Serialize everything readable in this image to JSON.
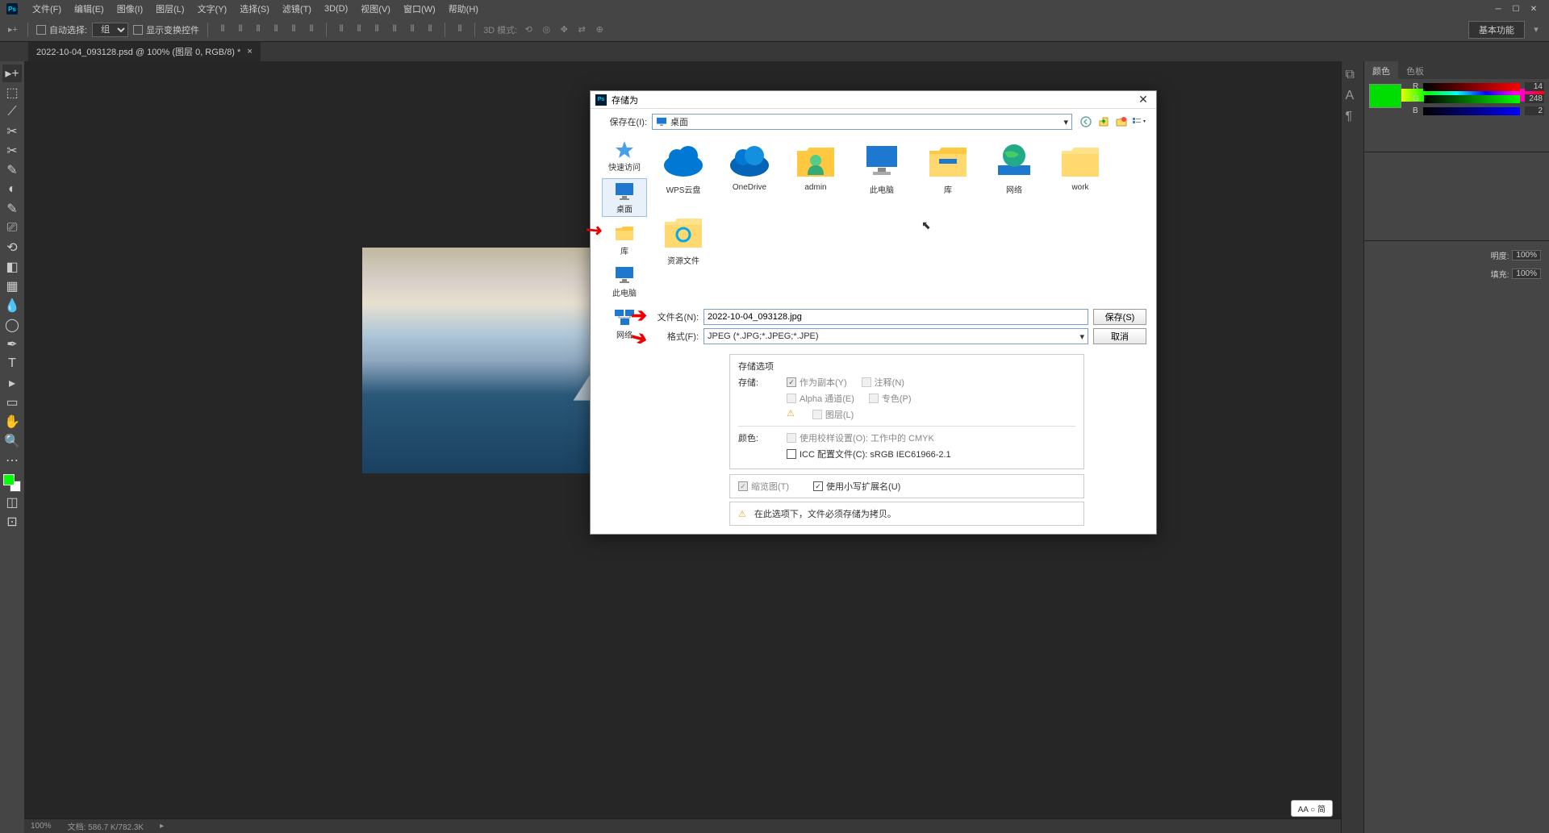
{
  "app": {
    "name": "Ps"
  },
  "menubar": {
    "items": [
      "文件(F)",
      "编辑(E)",
      "图像(I)",
      "图层(L)",
      "文字(Y)",
      "选择(S)",
      "滤镜(T)",
      "3D(D)",
      "视图(V)",
      "窗口(W)",
      "帮助(H)"
    ]
  },
  "optionsbar": {
    "auto_select": "自动选择:",
    "group": "组",
    "show_transform": "显示变换控件",
    "mode_3d": "3D 模式:",
    "basic_func": "基本功能"
  },
  "document_tab": "2022-10-04_093128.psd @ 100% (图层 0, RGB/8) *",
  "color_panel": {
    "tab1": "颜色",
    "tab2": "色板",
    "r_label": "R",
    "r_val": "14",
    "g_label": "G",
    "g_val": "248",
    "b_label": "B",
    "b_val": "2"
  },
  "layers": {
    "opacity_lbl": "明度:",
    "opacity_val": "100%",
    "fill_lbl": "填充:",
    "fill_val": "100%"
  },
  "dialog": {
    "title": "存储为",
    "save_in": "保存在(I):",
    "location": "桌面",
    "places": {
      "quickaccess": "快速访问",
      "desktop": "桌面",
      "library": "库",
      "thispc": "此电脑",
      "network": "网络"
    },
    "files": {
      "wps": "WPS云盘",
      "onedrive": "OneDrive",
      "admin": "admin",
      "thispc": "此电脑",
      "library": "库",
      "network": "网络",
      "work": "work",
      "resources": "资源文件"
    },
    "filename_label": "文件名(N):",
    "filename_value": "2022-10-04_093128.jpg",
    "format_label": "格式(F):",
    "format_value": "JPEG (*.JPG;*.JPEG;*.JPE)",
    "save_btn": "保存(S)",
    "cancel_btn": "取消",
    "options": {
      "header": "存储选项",
      "storage": "存储:",
      "as_copy": "作为副本(Y)",
      "notes": "注释(N)",
      "alpha": "Alpha 通道(E)",
      "spot": "专色(P)",
      "layers": "图层(L)",
      "color": "颜色:",
      "proof": "使用校样设置(O): 工作中的 CMYK",
      "icc": "ICC 配置文件(C): sRGB IEC61966-2.1",
      "thumbnail": "缩览图(T)",
      "lowercase": "使用小写扩展名(U)",
      "warning": "在此选项下，文件必须存储为拷贝。"
    }
  },
  "statusbar": {
    "zoom": "100%",
    "doc": "文档: 586.7 K/782.3K"
  },
  "aa": "AA ○ 简"
}
